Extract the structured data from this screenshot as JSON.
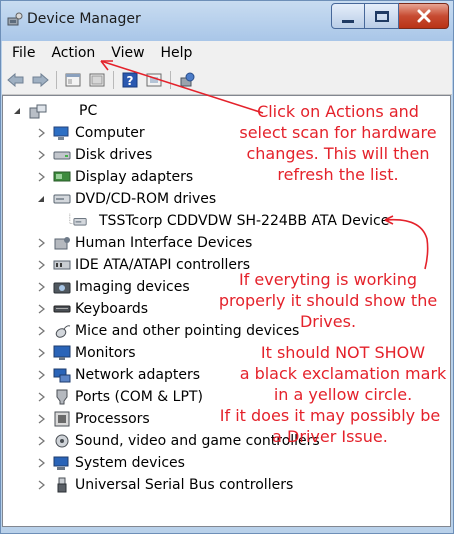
{
  "window": {
    "title": "Device Manager",
    "icon": "device-manager-icon"
  },
  "menu": [
    "File",
    "Action",
    "View",
    "Help"
  ],
  "toolbar": {
    "icons": [
      "back-arrow-icon",
      "forward-arrow-icon",
      "properties-icon",
      "show-hidden-icon",
      "help-icon",
      "scan-hardware-icon",
      "device-settings-icon"
    ]
  },
  "tree": {
    "root": "PC",
    "items": [
      {
        "label": "Computer",
        "icon": "computer-icon",
        "expanded": false
      },
      {
        "label": "Disk drives",
        "icon": "disk-drive-icon",
        "expanded": false
      },
      {
        "label": "Display adapters",
        "icon": "display-adapter-icon",
        "expanded": false
      },
      {
        "label": "DVD/CD-ROM drives",
        "icon": "dvd-drive-icon",
        "expanded": true
      },
      {
        "label": "TSSTcorp CDDVDW SH-224BB ATA Device",
        "icon": "dvd-device-icon",
        "child": true
      },
      {
        "label": "Human Interface Devices",
        "icon": "hid-icon",
        "expanded": false
      },
      {
        "label": "IDE ATA/ATAPI controllers",
        "icon": "ide-controller-icon",
        "expanded": false
      },
      {
        "label": "Imaging devices",
        "icon": "camera-icon",
        "expanded": false
      },
      {
        "label": "Keyboards",
        "icon": "keyboard-icon",
        "expanded": false
      },
      {
        "label": "Mice and other pointing devices",
        "icon": "mouse-icon",
        "expanded": false
      },
      {
        "label": "Monitors",
        "icon": "monitor-icon",
        "expanded": false
      },
      {
        "label": "Network adapters",
        "icon": "network-adapter-icon",
        "expanded": false
      },
      {
        "label": "Ports (COM & LPT)",
        "icon": "port-icon",
        "expanded": false
      },
      {
        "label": "Processors",
        "icon": "processor-icon",
        "expanded": false
      },
      {
        "label": "Sound, video and game controllers",
        "icon": "sound-icon",
        "expanded": false
      },
      {
        "label": "System devices",
        "icon": "system-device-icon",
        "expanded": false
      },
      {
        "label": "Universal Serial Bus controllers",
        "icon": "usb-icon",
        "expanded": false
      }
    ]
  },
  "annotations": {
    "scan_note": [
      "Click on Actions and",
      "select scan for hardware",
      "changes. This will then",
      " refresh the list."
    ],
    "drives_note": [
      "If everyting is working",
      "properly it should show the",
      "Drives."
    ],
    "warning_note": [
      "It should NOT SHOW",
      "a black exclamation mark",
      "in a yellow circle."
    ],
    "driver_note": [
      "If it does it may possibly be",
      "a Driver Issue."
    ],
    "color": "#e4222b"
  }
}
